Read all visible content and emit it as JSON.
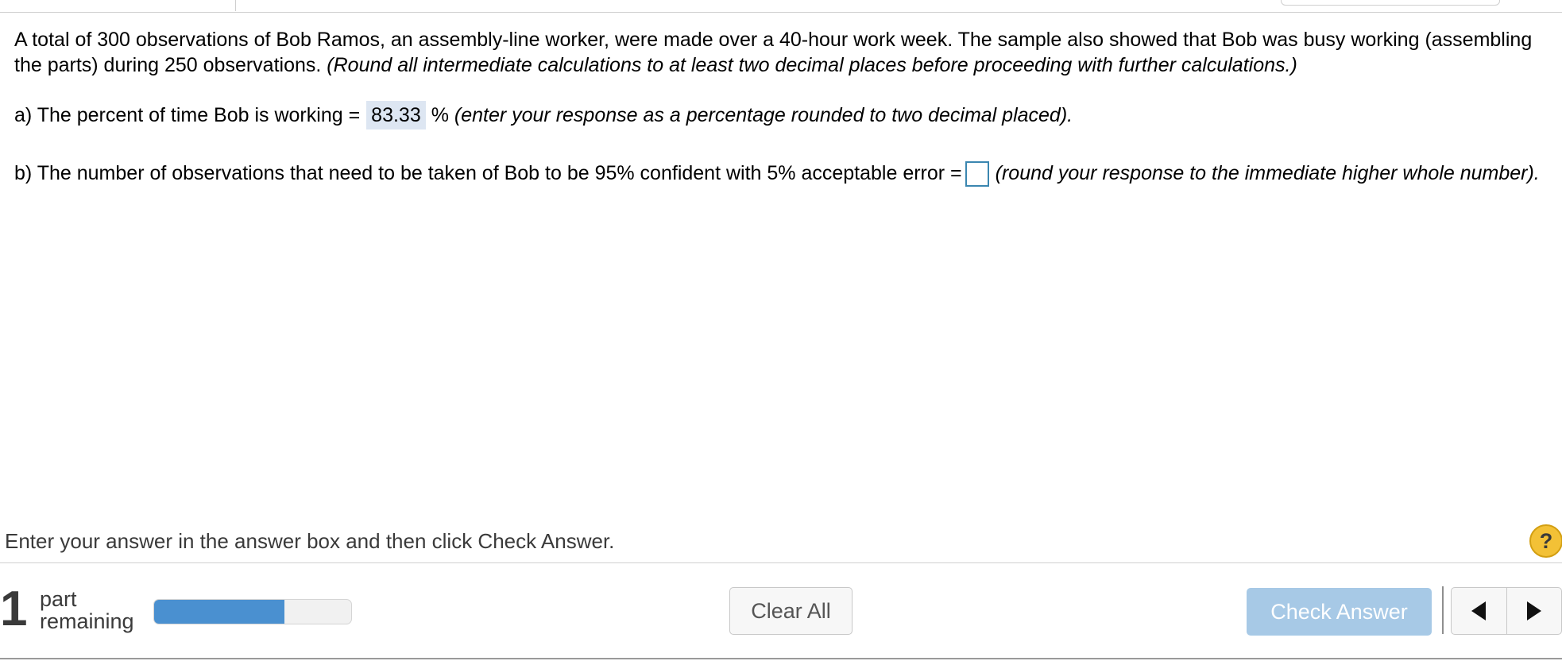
{
  "question": {
    "intro_text": "A total of 300 observations of Bob Ramos, an assembly-line worker, were made over a 40-hour work week. The sample also showed that Bob was busy working (assembling the parts) during 250 observations.",
    "intro_note": "(Round all intermediate calculations to at least two decimal places before proceeding with further calculations.)",
    "part_a": {
      "prefix": "a) The percent of time Bob is working =",
      "answer_value": "83.33",
      "unit": "%",
      "note": "(enter your response as a percentage rounded to two decimal placed)."
    },
    "part_b": {
      "prefix": "b) The number of observations that need to be taken of Bob to be 95% confident with 5% acceptable error =",
      "answer_value": "",
      "note": "(round your response to the immediate higher whole number)."
    }
  },
  "footer": {
    "instruction": "Enter your answer in the answer box and then click Check Answer.",
    "help_label": "?",
    "parts_remaining_count": "1",
    "parts_remaining_label": "part remaining",
    "progress_fraction": 0.66,
    "clear_all_label": "Clear All",
    "check_answer_label": "Check Answer",
    "prev_icon": "triangle-left-icon",
    "next_icon": "triangle-right-icon"
  },
  "colors": {
    "progress_fill": "#4a90d0",
    "check_button": "#a7c9e6",
    "help_button": "#f3c136",
    "filled_answer_bg": "#dde6f2",
    "answer_box_border": "#3b86b0"
  }
}
